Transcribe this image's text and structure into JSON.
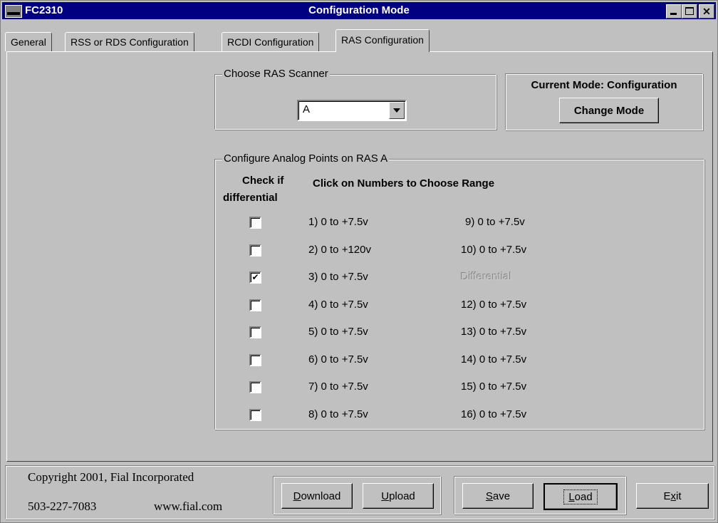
{
  "window": {
    "app_name": "FC2310",
    "title": "Configuration Mode"
  },
  "tabs": [
    {
      "label": "General"
    },
    {
      "label": "RSS or RDS Configuration"
    },
    {
      "label": "RCDI Configuration"
    },
    {
      "label": "RAS Configuration"
    }
  ],
  "scanner": {
    "group_label": "Choose RAS Scanner",
    "selected": "A"
  },
  "mode": {
    "label": "Current Mode: Configuration",
    "button": "Change Mode"
  },
  "analog": {
    "group_label": "Configure Analog Points on RAS A",
    "check_header_1": "Check if",
    "check_header_2": "differential",
    "range_header": "Click on Numbers to Choose Range",
    "rows": [
      {
        "checked": false,
        "left": "1)  0 to +7.5v",
        "right": "9)  0 to +7.5v"
      },
      {
        "checked": false,
        "left": "2)  0 to +120v",
        "right": "10)  0 to +7.5v"
      },
      {
        "checked": true,
        "left": "3)  0 to +7.5v",
        "right": "Differential"
      },
      {
        "checked": false,
        "left": "4)  0 to +7.5v",
        "right": "12)  0 to +7.5v"
      },
      {
        "checked": false,
        "left": "5)  0 to +7.5v",
        "right": "13)  0 to +7.5v"
      },
      {
        "checked": false,
        "left": "6)  0 to +7.5v",
        "right": "14)  0 to +7.5v"
      },
      {
        "checked": false,
        "left": "7)  0 to +7.5v",
        "right": "15)  0 to +7.5v"
      },
      {
        "checked": false,
        "left": "8)  0 to +7.5v",
        "right": "16)  0 to +7.5v"
      }
    ]
  },
  "footer": {
    "copyright": "Copyright 2001, Fial Incorporated",
    "phone": "503-227-7083",
    "website": "www.fial.com",
    "download_first": "D",
    "download_rest": "ownload",
    "upload_first": "U",
    "upload_rest": "pload",
    "save_first": "S",
    "save_rest": "ave",
    "load_first": "L",
    "load_rest": "oad",
    "exit_pre": "E",
    "exit_ul": "x",
    "exit_post": "it"
  }
}
